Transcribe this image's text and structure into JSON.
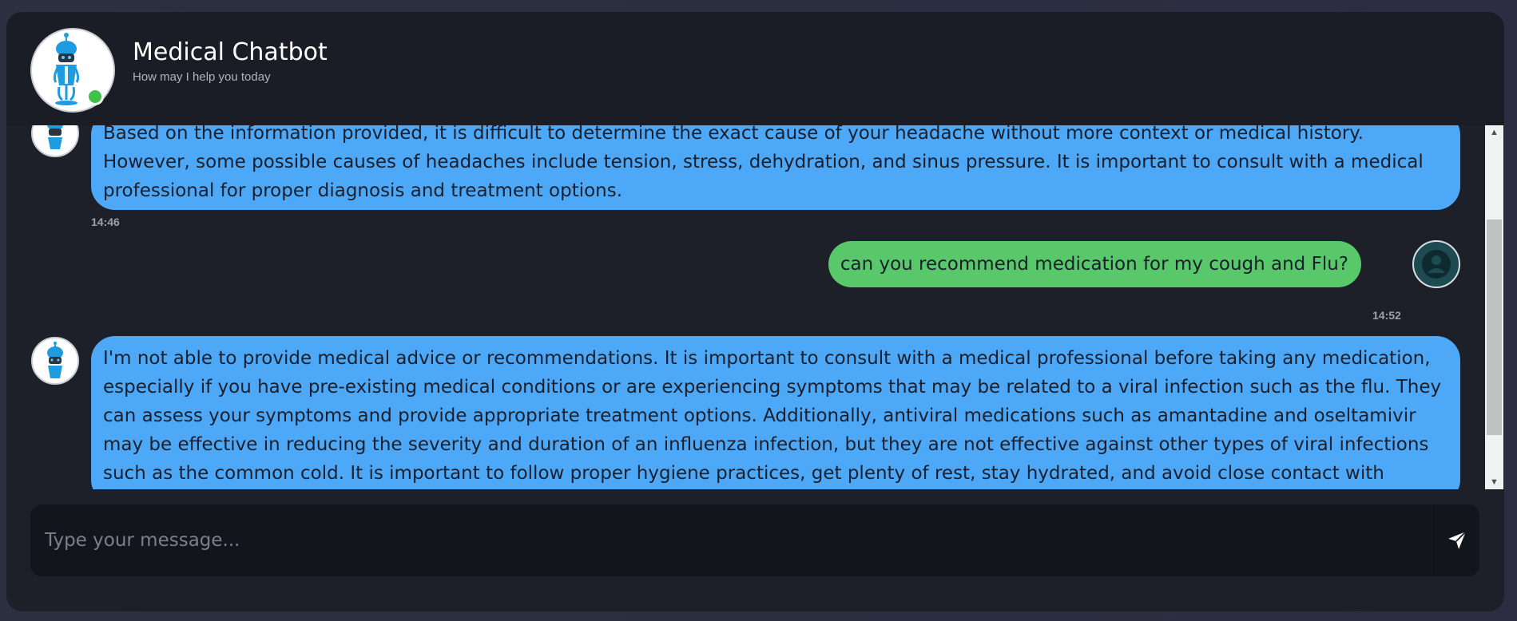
{
  "header": {
    "title": "Medical Chatbot",
    "subtitle": "How may I help you today",
    "status": "online"
  },
  "messages": [
    {
      "sender": "bot",
      "text": "Based on the information provided, it is difficult to determine the exact cause of your headache without more context or medical history. However, some possible causes of headaches include tension, stress, dehydration, and sinus pressure. It is important to consult with a medical professional for proper diagnosis and treatment options.",
      "time": "14:46"
    },
    {
      "sender": "user",
      "text": "can you recommend medication for my cough and Flu?",
      "time": "14:52"
    },
    {
      "sender": "bot",
      "text": "I'm not able to provide medical advice or recommendations. It is important to consult with a medical professional before taking any medication, especially if you have pre-existing medical conditions or are experiencing symptoms that may be related to a viral infection such as the flu. They can assess your symptoms and provide appropriate treatment options. Additionally, antiviral medications such as amantadine and oseltamivir may be effective in reducing the severity and duration of an influenza infection, but they are not effective against other types of viral infections such as the common cold. It is important to follow proper hygiene practices, get plenty of rest, stay hydrated, and avoid close contact with others to help reduce the spread of illness."
    }
  ],
  "input": {
    "placeholder": "Type your message...",
    "value": ""
  },
  "icons": {
    "send": "send-icon",
    "user_avatar": "user-icon",
    "bot_avatar": "robot-icon"
  },
  "colors": {
    "bot_bubble": "#4da8f8",
    "user_bubble": "#58c86a",
    "online": "#3ec24a",
    "background": "#1d2029"
  }
}
